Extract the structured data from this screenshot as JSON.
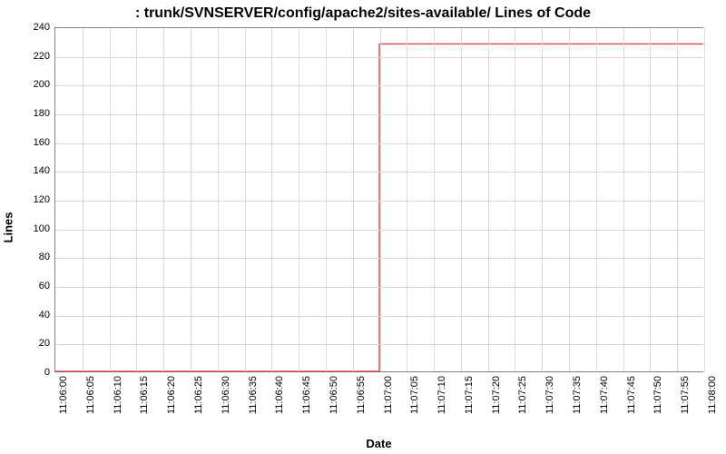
{
  "chart_data": {
    "type": "line",
    "title": ": trunk/SVNSERVER/config/apache2/sites-available/ Lines of Code",
    "xlabel": "Date",
    "ylabel": "Lines",
    "ylim": [
      0,
      240
    ],
    "y_ticks": [
      0,
      20,
      40,
      60,
      80,
      100,
      120,
      140,
      160,
      180,
      200,
      220,
      240
    ],
    "x_ticks": [
      "11:06:00",
      "11:06:05",
      "11:06:10",
      "11:06:15",
      "11:06:20",
      "11:06:25",
      "11:06:30",
      "11:06:35",
      "11:06:40",
      "11:06:45",
      "11:06:50",
      "11:06:55",
      "11:07:00",
      "11:07:05",
      "11:07:10",
      "11:07:15",
      "11:07:20",
      "11:07:25",
      "11:07:30",
      "11:07:35",
      "11:07:40",
      "11:07:45",
      "11:07:50",
      "11:07:55",
      "11:08:00"
    ],
    "series": [
      {
        "name": "Lines of Code",
        "color": "#d62728",
        "x": [
          "11:06:00",
          "11:06:05",
          "11:06:10",
          "11:06:15",
          "11:06:20",
          "11:06:25",
          "11:06:30",
          "11:06:35",
          "11:06:40",
          "11:06:45",
          "11:06:50",
          "11:06:55",
          "11:07:00",
          "11:07:05",
          "11:07:10",
          "11:07:15",
          "11:07:20",
          "11:07:25",
          "11:07:30",
          "11:07:35",
          "11:07:40",
          "11:07:45",
          "11:07:50",
          "11:07:55",
          "11:08:00"
        ],
        "values": [
          0,
          0,
          0,
          0,
          0,
          0,
          0,
          0,
          0,
          0,
          0,
          0,
          229,
          229,
          229,
          229,
          229,
          229,
          229,
          229,
          229,
          229,
          229,
          229,
          229
        ]
      }
    ]
  }
}
